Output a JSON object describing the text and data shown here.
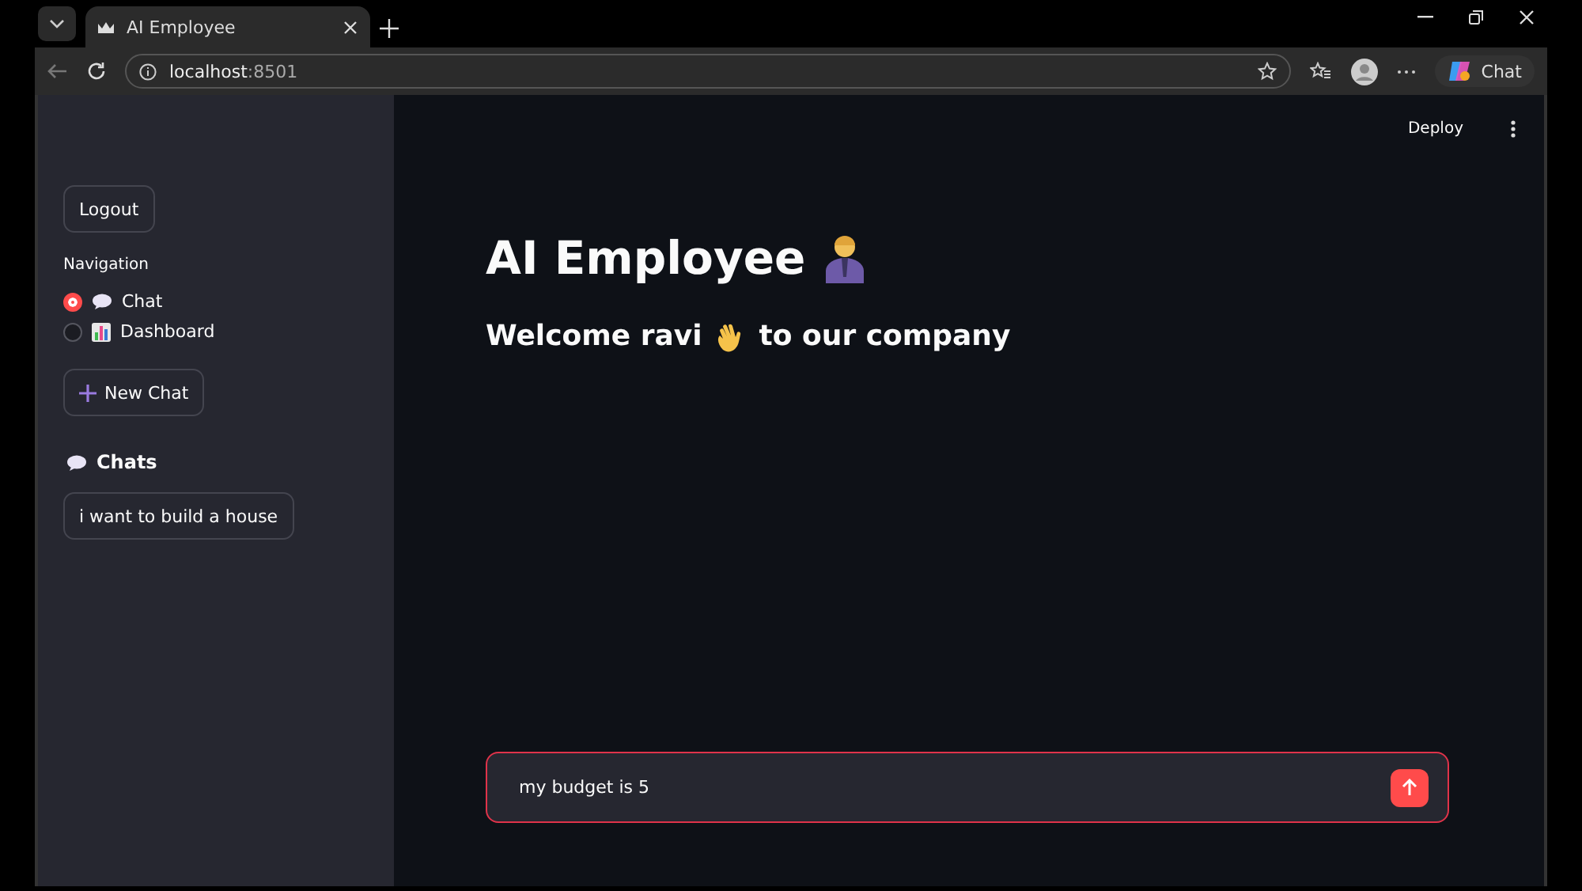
{
  "browser": {
    "tab_title": "AI Employee",
    "url_host": "localhost",
    "url_port": ":8501",
    "chat_button": "Chat"
  },
  "header": {
    "deploy": "Deploy"
  },
  "sidebar": {
    "logout": "Logout",
    "nav_label": "Navigation",
    "nav_items": [
      {
        "label": "Chat",
        "kind": "chat",
        "selected": true
      },
      {
        "label": "Dashboard",
        "kind": "chart",
        "selected": false
      }
    ],
    "new_chat": "New Chat",
    "chats_title": "Chats",
    "chats": [
      "i want to build a house"
    ]
  },
  "main": {
    "title": "AI Employee",
    "welcome_before": "Welcome ravi",
    "welcome_after": "to our company"
  },
  "chat_input": {
    "value": "my budget is 5"
  }
}
